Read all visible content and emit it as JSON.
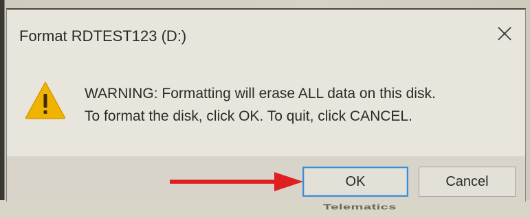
{
  "dialog": {
    "title": "Format RDTEST123 (D:)",
    "close_icon": "close-icon",
    "warning_icon": "warning-triangle-icon",
    "message_line1": "WARNING: Formatting will erase ALL data on this disk.",
    "message_line2": "To format the disk, click OK. To quit, click CANCEL.",
    "buttons": {
      "ok_label": "OK",
      "cancel_label": "Cancel"
    }
  },
  "annotation": {
    "arrow_icon": "red-arrow-icon",
    "arrow_color": "#e02020"
  },
  "background": {
    "partial_text": "Telematics"
  },
  "colors": {
    "warning_fill": "#f0b400",
    "focus_border": "#3d8fd0",
    "dialog_bg": "#e8e5dc"
  }
}
